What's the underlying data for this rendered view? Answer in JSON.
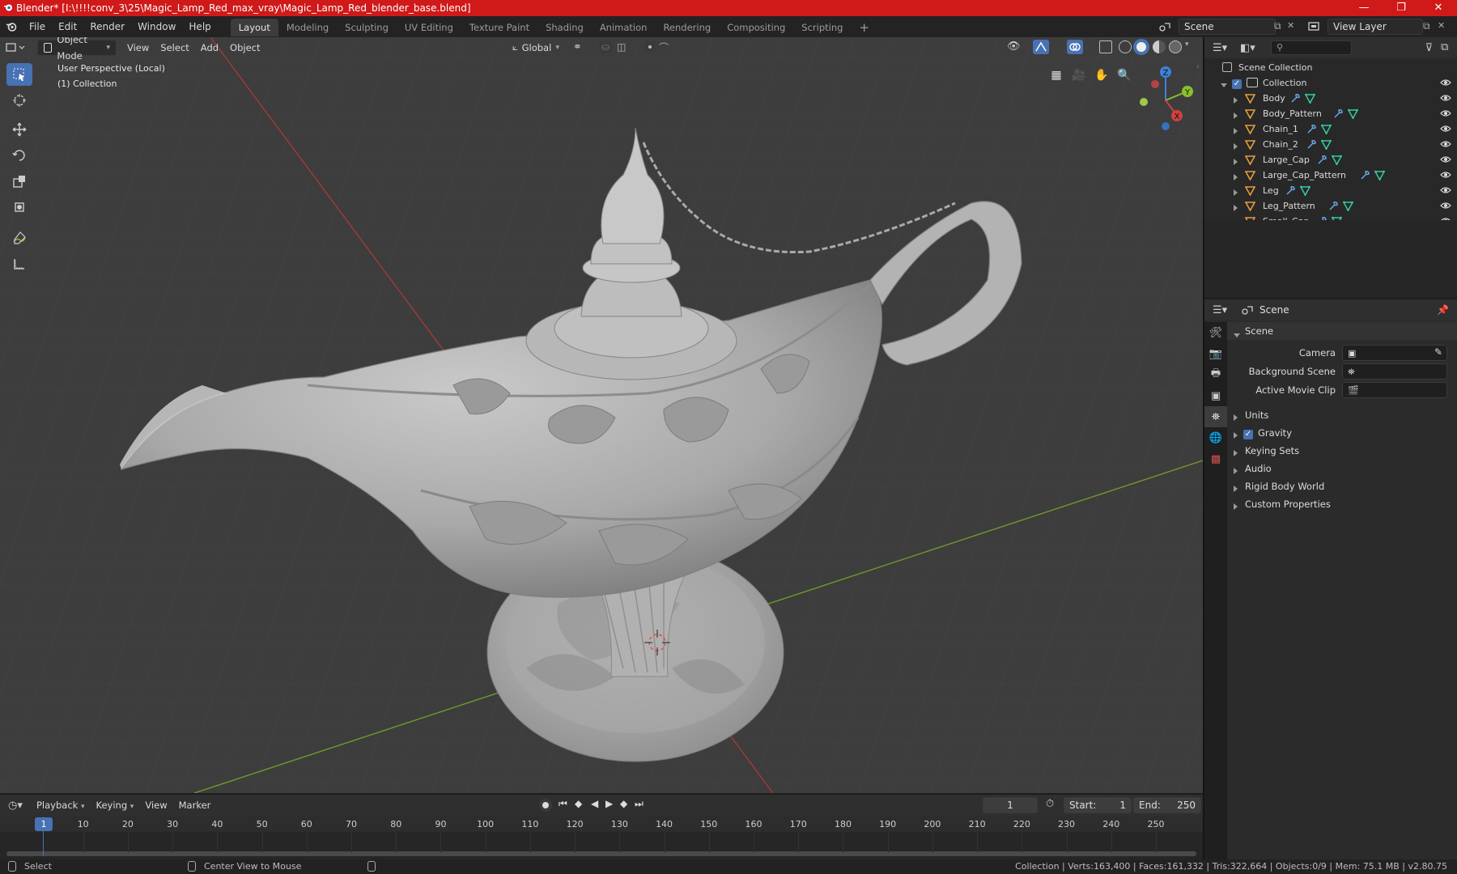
{
  "titlebar": {
    "title": "Blender* [I:\\!!!!conv_3\\25\\Magic_Lamp_Red_max_vray\\Magic_Lamp_Red_blender_base.blend]",
    "minimize": "—",
    "maximize": "❐",
    "close": "✕"
  },
  "menu": {
    "items": [
      "File",
      "Edit",
      "Render",
      "Window",
      "Help"
    ]
  },
  "workspaces": {
    "tabs": [
      "Layout",
      "Modeling",
      "Sculpting",
      "UV Editing",
      "Texture Paint",
      "Shading",
      "Animation",
      "Rendering",
      "Compositing",
      "Scripting"
    ],
    "active": "Layout",
    "add": "+"
  },
  "scene_selector": {
    "value": "Scene"
  },
  "view_layer_selector": {
    "value": "View Layer"
  },
  "viewport_header": {
    "mode": "Object Mode",
    "menus": [
      "View",
      "Select",
      "Add",
      "Object"
    ],
    "orientation": "Global"
  },
  "viewport": {
    "perspective_label": "User Perspective (Local)",
    "collection_label": "(1) Collection",
    "gizmo_axes": {
      "z": "Z",
      "y": "Y",
      "x": "X"
    }
  },
  "outliner": {
    "search_placeholder": "",
    "root": "Scene Collection",
    "collection": "Collection",
    "objects": [
      {
        "name": "Body"
      },
      {
        "name": "Body_Pattern"
      },
      {
        "name": "Chain_1"
      },
      {
        "name": "Chain_2"
      },
      {
        "name": "Large_Cap"
      },
      {
        "name": "Large_Cap_Pattern"
      },
      {
        "name": "Leg"
      },
      {
        "name": "Leg_Pattern"
      },
      {
        "name": "Small_Cap"
      }
    ]
  },
  "properties": {
    "context": "Scene",
    "panel_title": "Scene",
    "fields": {
      "camera_label": "Camera",
      "background_scene_label": "Background Scene",
      "active_movie_clip_label": "Active Movie Clip"
    },
    "subpanels": [
      "Units",
      "Gravity",
      "Keying Sets",
      "Audio",
      "Rigid Body World",
      "Custom Properties"
    ],
    "gravity_checked": true
  },
  "timeline": {
    "menus": [
      "Playback",
      "Keying",
      "View",
      "Marker"
    ],
    "current_frame": "1",
    "start_label": "Start:",
    "start_value": "1",
    "end_label": "End:",
    "end_value": "250",
    "ruler": [
      "1",
      "10",
      "20",
      "30",
      "40",
      "50",
      "60",
      "70",
      "80",
      "90",
      "100",
      "110",
      "120",
      "130",
      "140",
      "150",
      "160",
      "170",
      "180",
      "190",
      "200",
      "210",
      "220",
      "230",
      "240",
      "250"
    ]
  },
  "statusbar": {
    "left_hint": "Select",
    "mid_hint": "Center View to Mouse",
    "stats": "Collection | Verts:163,400 | Faces:161,332 | Tris:322,664 | Objects:0/9 | Mem: 75.1 MB | v2.80.75"
  },
  "colors": {
    "accent": "#4772b3",
    "titlebar": "#d01919",
    "viewport_bg": "#3d3d3d",
    "x_axis": "#d04040",
    "y_axis": "#8ac02b",
    "z_axis": "#3b82d9",
    "mesh_icon": "#e69d3b",
    "modifier_icon": "#6aa7e6",
    "mesh_data_icon": "#35c9a6"
  }
}
